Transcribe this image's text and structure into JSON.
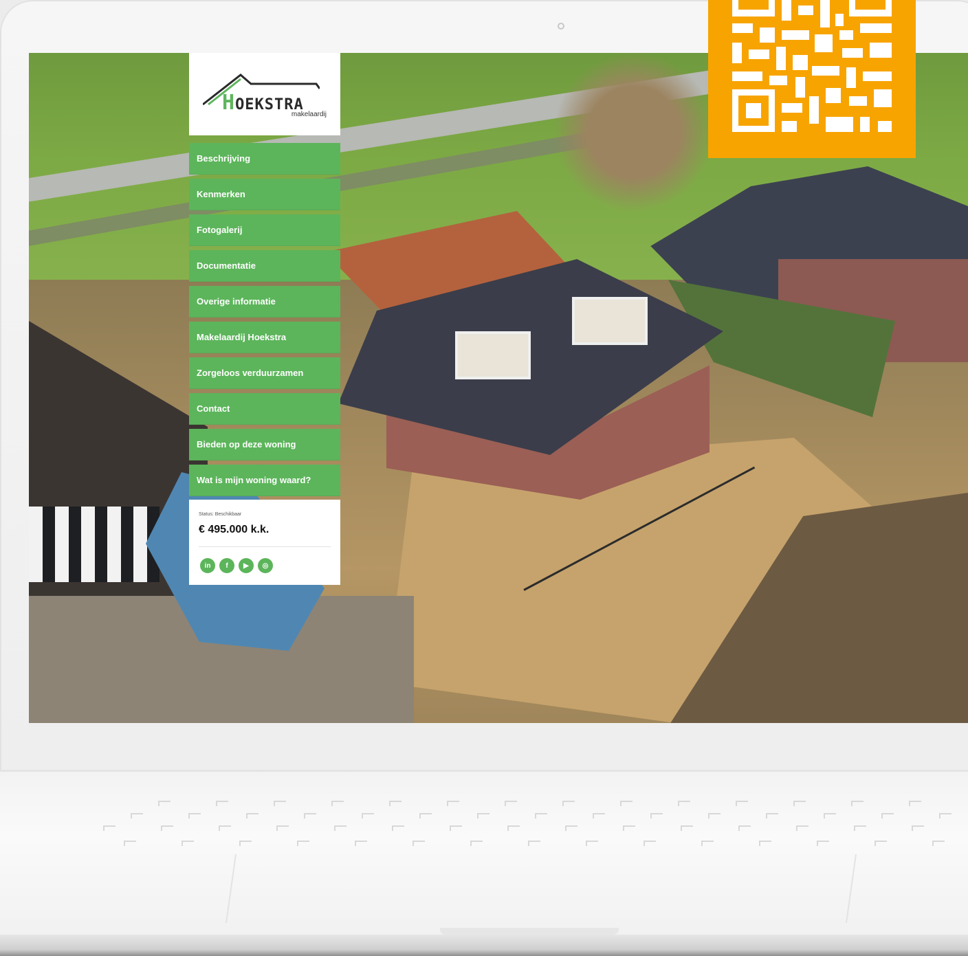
{
  "logo": {
    "initial": "H",
    "name": "OEKSTRA",
    "sub": "makelaardij"
  },
  "menu": {
    "items": [
      {
        "label": "Beschrijving"
      },
      {
        "label": "Kenmerken"
      },
      {
        "label": "Fotogalerij"
      },
      {
        "label": "Documentatie"
      },
      {
        "label": "Overige informatie"
      },
      {
        "label": "Makelaardij Hoekstra"
      },
      {
        "label": "Zorgeloos verduurzamen"
      },
      {
        "label": "Contact"
      },
      {
        "label": "Bieden op deze woning"
      },
      {
        "label": "Wat is mijn woning waard?"
      }
    ]
  },
  "listing": {
    "status": "Status: Beschikbaar",
    "price": "€ 495.000 k.k."
  },
  "socials": [
    {
      "icon": "linkedin-icon",
      "glyph": "in"
    },
    {
      "icon": "facebook-icon",
      "glyph": "f"
    },
    {
      "icon": "youtube-icon",
      "glyph": "▶"
    },
    {
      "icon": "instagram-icon",
      "glyph": "◎"
    }
  ],
  "colors": {
    "brand_green": "#5cb55b",
    "qr_orange": "#f7a400"
  }
}
